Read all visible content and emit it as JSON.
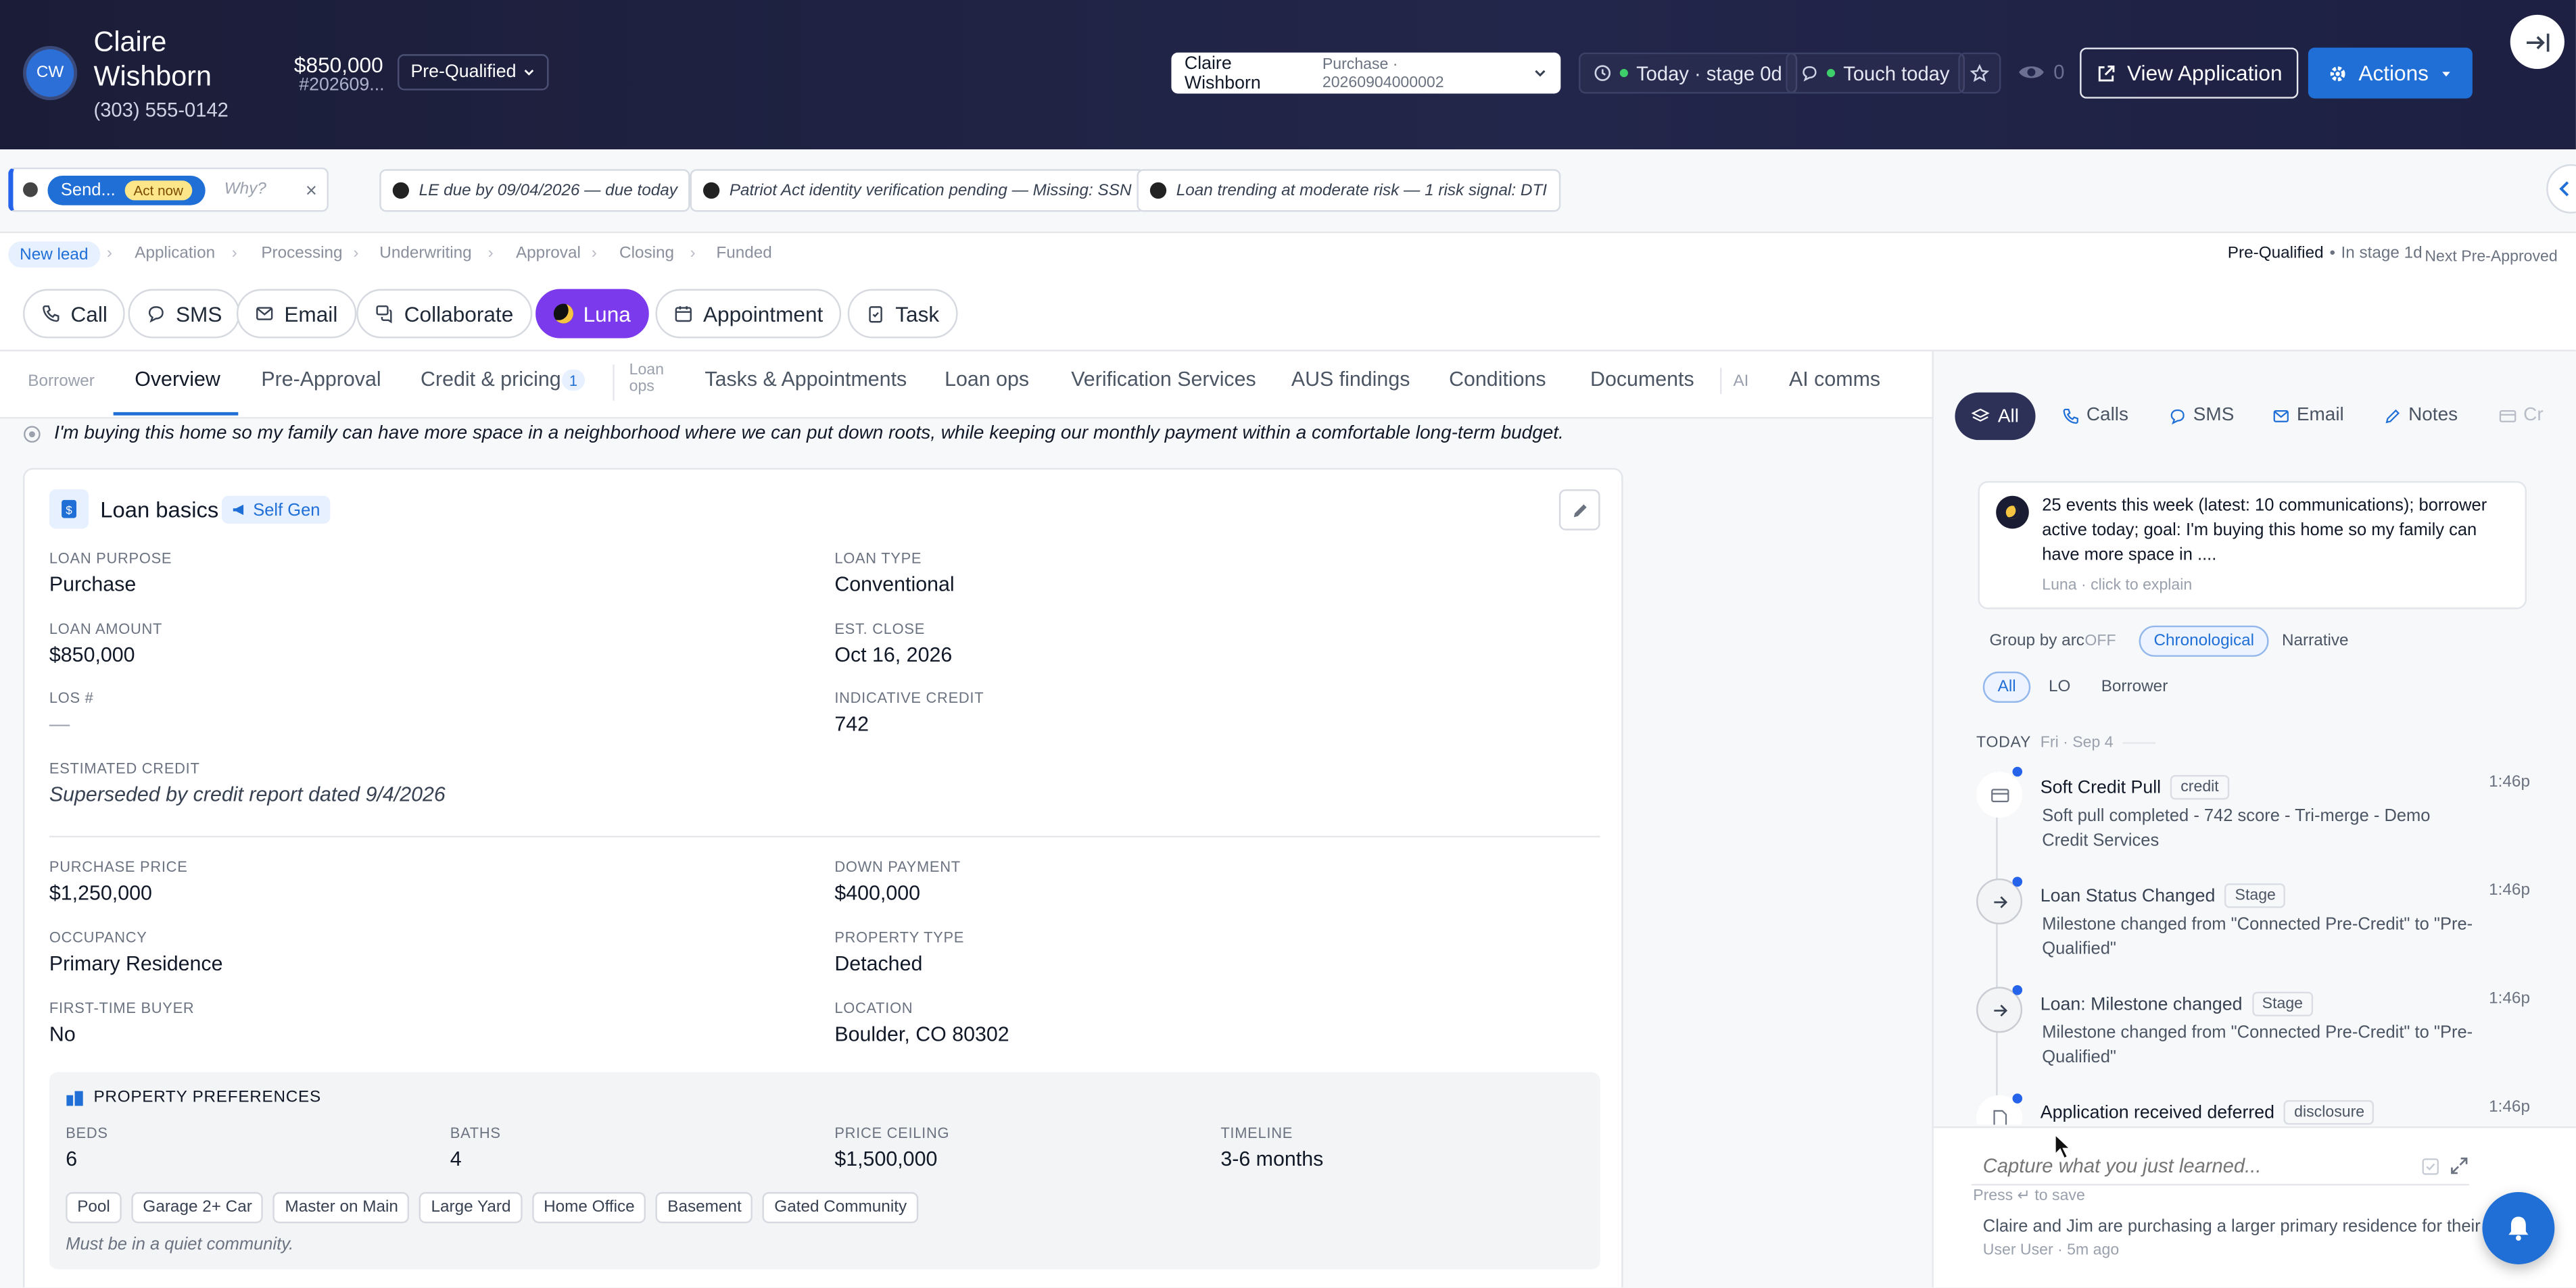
{
  "header": {
    "avatar_initials": "CW",
    "name": "Claire Wishborn",
    "phone": "(303) 555-0142",
    "amount": "$850,000",
    "loan_number": "#202609...",
    "status": "Pre-Qualified",
    "loan_selector": {
      "name": "Claire Wishborn",
      "detail": "Purchase · 20260904000002"
    },
    "stage_chip": "Today · stage 0d",
    "touch_chip": "Touch today",
    "view_count": "0",
    "view_application": "View Application",
    "actions": "Actions"
  },
  "alerts": {
    "send_label": "Send...",
    "act_now": "Act now",
    "why": "Why?",
    "items": [
      "LE due by 09/04/2026 — due today",
      "Patriot Act identity verification pending — Missing: SSN",
      "Loan trending at moderate risk — 1 risk signal: DTI"
    ]
  },
  "pipeline": {
    "stages": [
      "New lead",
      "Application",
      "Processing",
      "Underwriting",
      "Approval",
      "Closing",
      "Funded"
    ],
    "current": "Pre-Qualified",
    "in_stage": "In stage 1d",
    "next": "Next Pre-Approved"
  },
  "actions_bar": [
    "Call",
    "SMS",
    "Email",
    "Collaborate",
    "Luna",
    "Appointment",
    "Task"
  ],
  "tabs": {
    "borrower": "Borrower",
    "overview": "Overview",
    "pre_approval": "Pre-Approval",
    "credit_pricing": "Credit & pricing",
    "credit_badge": "1",
    "loan_ops_small": "Loan ops",
    "tasks": "Tasks & Appointments",
    "loan_ops": "Loan ops",
    "verification": "Verification Services",
    "aus": "AUS findings",
    "conditions": "Conditions",
    "documents": "Documents",
    "ai": "AI",
    "ai_comms": "AI comms"
  },
  "goal": "I'm buying this home so my family can have more space in a neighborhood where we can put down roots, while keeping our monthly payment within a comfortable long-term budget.",
  "loan_basics": {
    "title": "Loan basics",
    "source_tag": "Self Gen",
    "fields": {
      "loan_purpose": {
        "label": "LOAN PURPOSE",
        "value": "Purchase"
      },
      "loan_type": {
        "label": "LOAN TYPE",
        "value": "Conventional"
      },
      "loan_amount": {
        "label": "LOAN AMOUNT",
        "value": "$850,000"
      },
      "est_close": {
        "label": "EST. CLOSE",
        "value": "Oct 16, 2026"
      },
      "los": {
        "label": "LOS #",
        "value": "—"
      },
      "indicative_credit": {
        "label": "INDICATIVE CREDIT",
        "value": "742"
      },
      "estimated_credit": {
        "label": "ESTIMATED CREDIT",
        "value": "Superseded by credit report dated 9/4/2026"
      },
      "purchase_price": {
        "label": "PURCHASE PRICE",
        "value": "$1,250,000"
      },
      "down_payment": {
        "label": "DOWN PAYMENT",
        "value": "$400,000"
      },
      "occupancy": {
        "label": "OCCUPANCY",
        "value": "Primary Residence"
      },
      "property_type": {
        "label": "PROPERTY TYPE",
        "value": "Detached"
      },
      "first_time": {
        "label": "FIRST-TIME BUYER",
        "value": "No"
      },
      "location": {
        "label": "LOCATION",
        "value": "Boulder, CO 80302"
      }
    },
    "prefs": {
      "title": "PROPERTY PREFERENCES",
      "beds": {
        "label": "BEDS",
        "value": "6"
      },
      "baths": {
        "label": "BATHS",
        "value": "4"
      },
      "ceiling": {
        "label": "PRICE CEILING",
        "value": "$1,500,000"
      },
      "timeline": {
        "label": "TIMELINE",
        "value": "3-6 months"
      },
      "tags": [
        "Pool",
        "Garage 2+ Car",
        "Master on Main",
        "Large Yard",
        "Home Office",
        "Basement",
        "Gated Community"
      ],
      "note": "Must be in a quiet community."
    }
  },
  "panel": {
    "tabs": [
      "All",
      "Calls",
      "SMS",
      "Email",
      "Notes",
      "Cr"
    ],
    "summary": "25 events this week (latest: 10 communications); borrower active today; goal: I'm buying this home so my family can have more space in ....",
    "summary_footer": "Luna · click to explain",
    "group_by_arc": "Group by arc",
    "group_state": "OFF",
    "views": [
      "Chronological",
      "Narrative"
    ],
    "filters": [
      "All",
      "LO",
      "Borrower"
    ],
    "day_label": "TODAY",
    "day_date": "Fri · Sep 4",
    "events": [
      {
        "title": "Soft Credit Pull",
        "tag": "credit",
        "body": "Soft pull completed - 742 score - Tri-merge - Demo Credit Services",
        "time": "1:46p"
      },
      {
        "title": "Loan Status Changed",
        "tag": "Stage",
        "body": "Milestone changed from \"Connected Pre-Credit\" to \"Pre-Qualified\"",
        "time": "1:46p"
      },
      {
        "title": "Loan: Milestone changed",
        "tag": "Stage",
        "body": "Milestone changed from \"Connected Pre-Credit\" to \"Pre-Qualified\"",
        "time": "1:46p"
      },
      {
        "title": "Application received deferred",
        "tag": "disclosure",
        "body": "",
        "time": "1:46p"
      }
    ],
    "capture_placeholder": "Capture what you just learned...",
    "capture_hint": "Press ↵ to save",
    "note_text": "Claire and Jim are purchasing a larger primary residence for their",
    "note_meta": "User User · 5m ago"
  },
  "colors": {
    "header_bg": "#1b1d38",
    "accent": "#1f6fd6",
    "luna": "#7c3aed",
    "success": "#3ecf6a"
  }
}
